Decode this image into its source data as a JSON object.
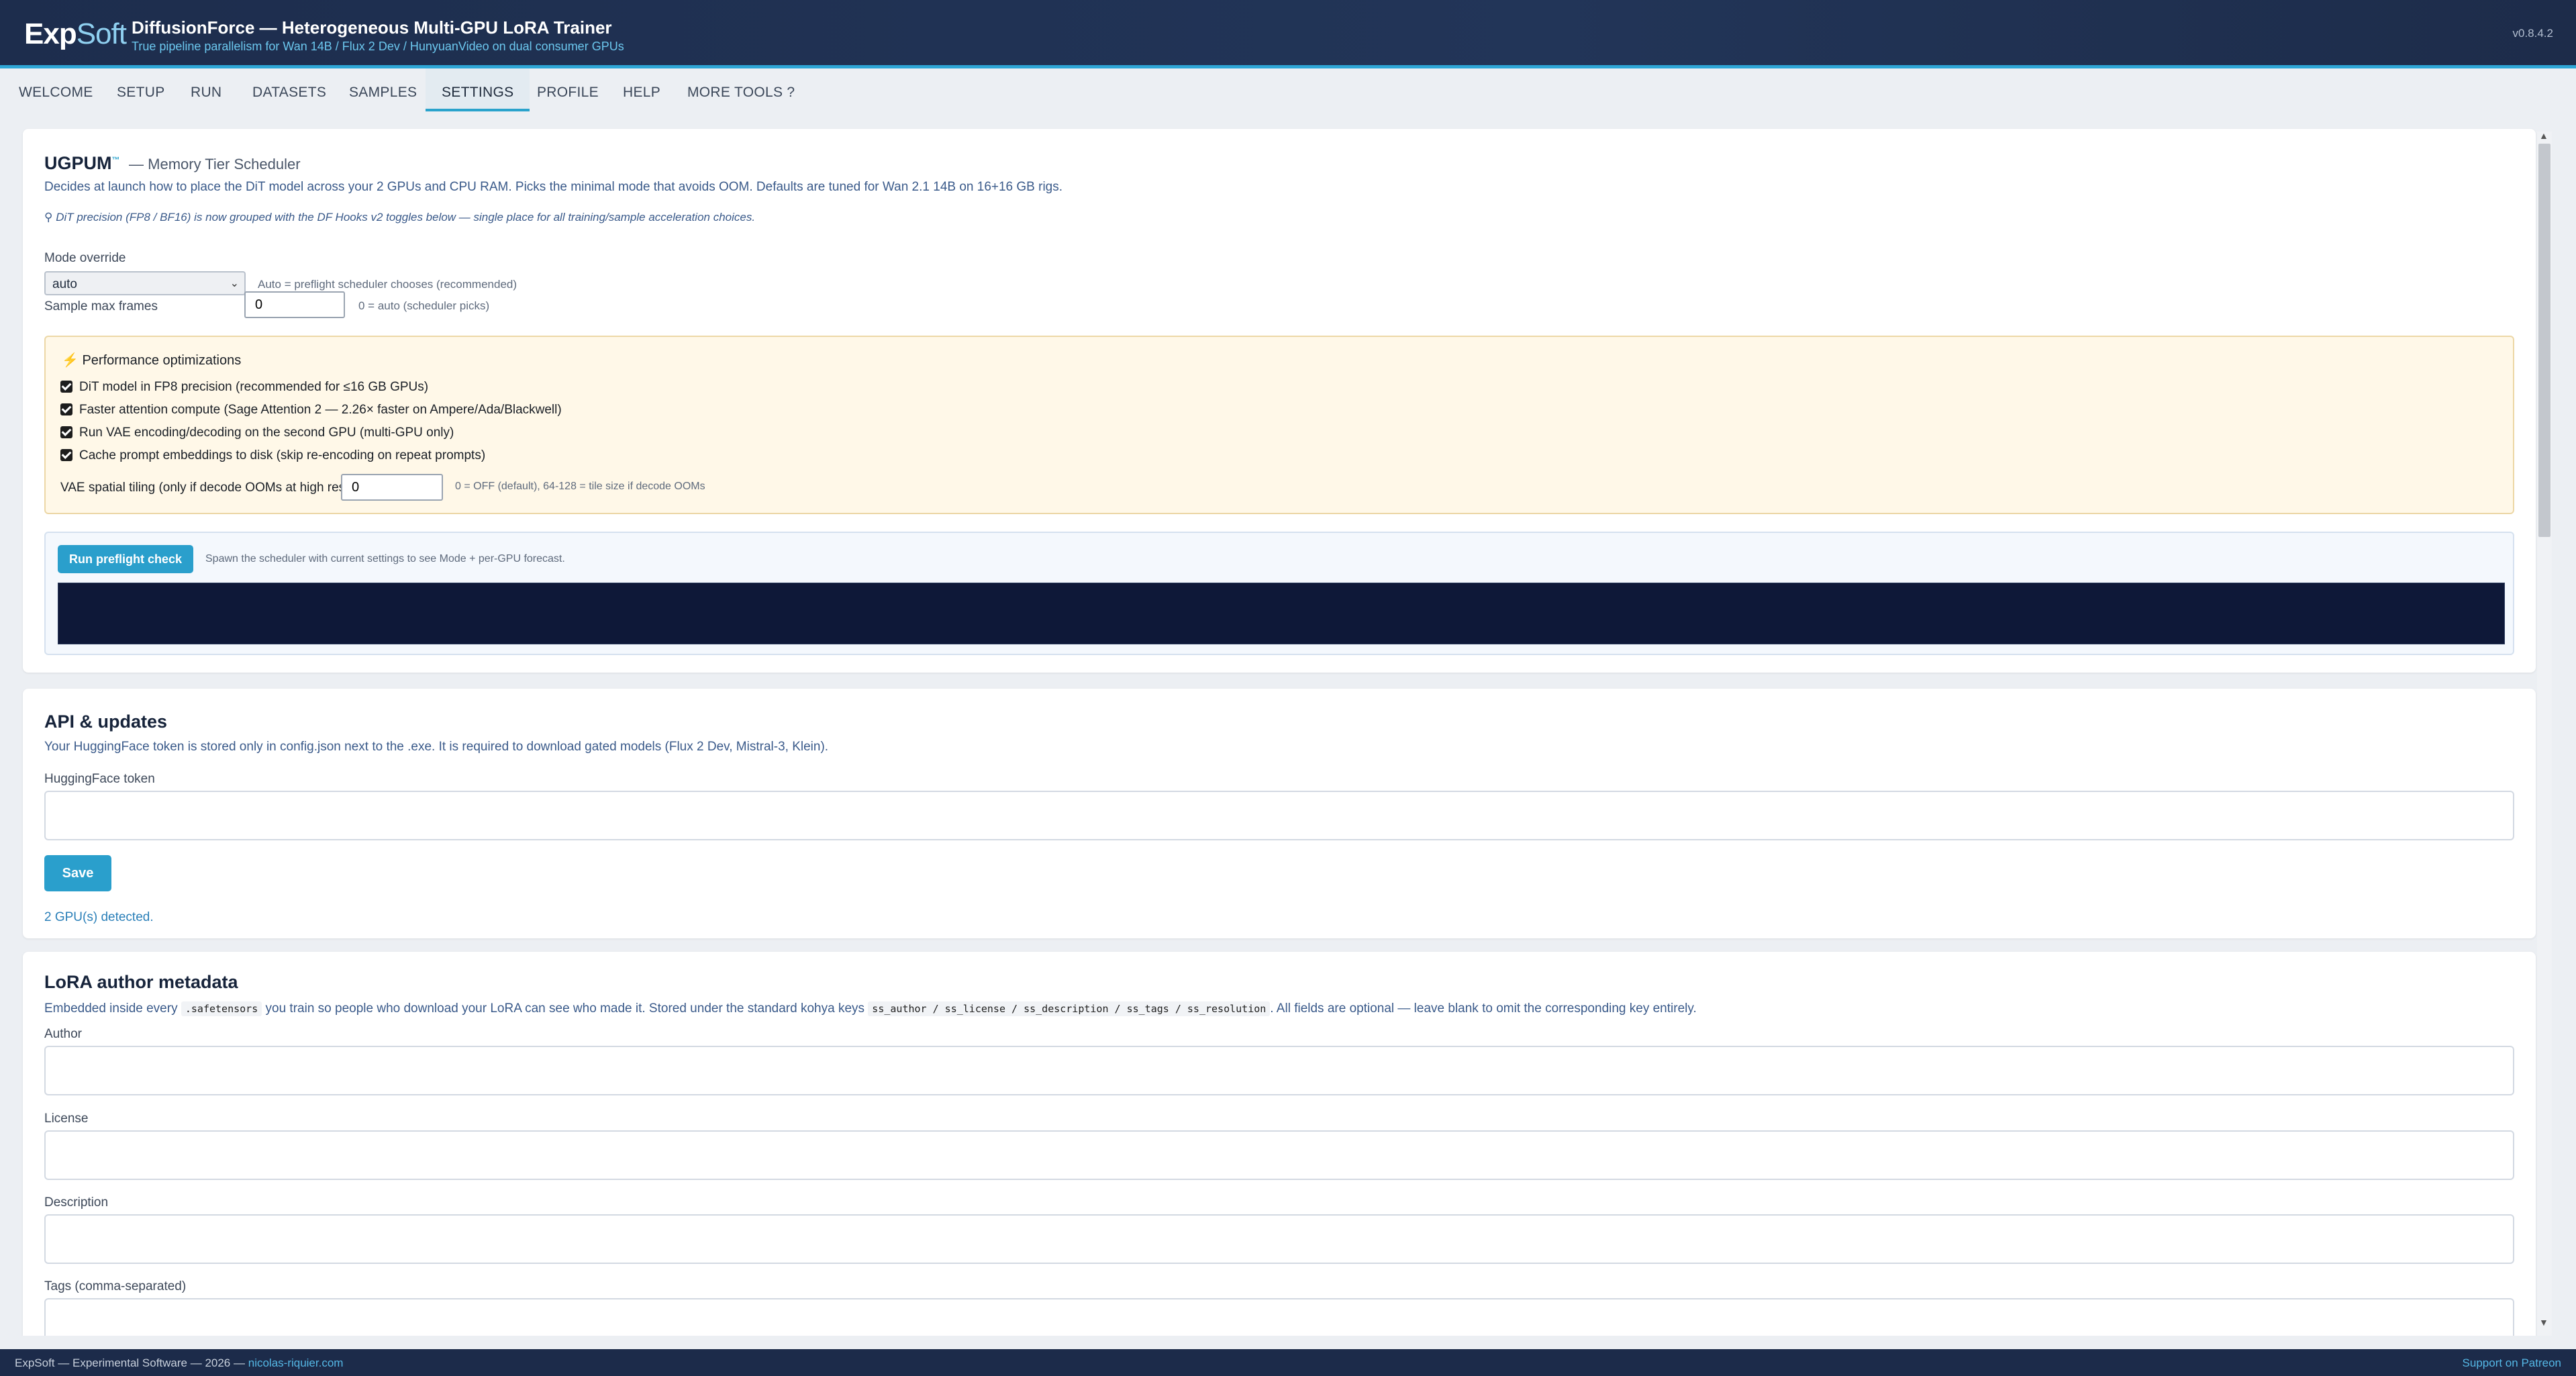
{
  "header": {
    "logo_bold": "Exp",
    "logo_rest": "Soft",
    "title": "DiffusionForce — Heterogeneous Multi-GPU LoRA Trainer",
    "subtitle": "True pipeline parallelism for Wan 14B / Flux 2 Dev / HunyuanVideo on dual consumer GPUs",
    "version": "v0.8.4.2"
  },
  "tabs": [
    {
      "label": "WELCOME"
    },
    {
      "label": "SETUP"
    },
    {
      "label": "RUN"
    },
    {
      "label": "DATASETS"
    },
    {
      "label": "SAMPLES"
    },
    {
      "label": "SETTINGS",
      "active": true
    },
    {
      "label": "PROFILE"
    },
    {
      "label": "HELP"
    },
    {
      "label": "MORE TOOLS ?"
    }
  ],
  "ugpum": {
    "title": "UGPUM",
    "tm": "™",
    "subtitle": "— Memory Tier Scheduler",
    "description": "Decides at launch how to place the DiT model across your 2 GPUs and CPU RAM. Picks the minimal mode that avoids OOM. Defaults are tuned for Wan 2.1 14B on 16+16 GB rigs.",
    "note": "DiT precision (FP8 / BF16) is now grouped with the DF Hooks v2 toggles below — single place for all training/sample acceleration choices.",
    "mode_label": "Mode override",
    "mode_value": "auto",
    "mode_hint": "Auto = preflight scheduler chooses (recommended)",
    "frames_label": "Sample max frames",
    "frames_value": "0",
    "frames_hint": "0 = auto (scheduler picks)",
    "perf": {
      "title": "Performance optimizations",
      "options": [
        {
          "label": "DiT model in FP8 precision (recommended for ≤16 GB GPUs)",
          "checked": true
        },
        {
          "label": "Faster attention compute (Sage Attention 2 — 2.26× faster on Ampere/Ada/Blackwell)",
          "checked": true
        },
        {
          "label": "Run VAE encoding/decoding on the second GPU (multi-GPU only)",
          "checked": true
        },
        {
          "label": "Cache prompt embeddings to disk (skip re-encoding on repeat prompts)",
          "checked": true
        }
      ],
      "tiling_label": "VAE spatial tiling (only if decode OOMs at high res):",
      "tiling_value": "0",
      "tiling_hint": "0 = OFF (default), 64-128 = tile size if decode OOMs"
    },
    "preflight_button": "Run preflight check",
    "preflight_hint": "Spawn the scheduler with current settings to see Mode + per-GPU forecast."
  },
  "api": {
    "title": "API & updates",
    "description": "Your HuggingFace token is stored only in config.json next to the .exe. It is required to download gated models (Flux 2 Dev, Mistral-3, Klein).",
    "token_label": "HuggingFace token",
    "token_value": "",
    "save_button": "Save",
    "status": "2 GPU(s) detected."
  },
  "lora_meta": {
    "title": "LoRA author metadata",
    "desc_1": "Embedded inside every",
    "desc_ext": ".safetensors",
    "desc_2": "you train so people who download your LoRA can see who made it. Stored under the standard kohya keys",
    "keys": "ss_author / ss_license / ss_description / ss_tags / ss_resolution",
    "desc_3": ". All fields are optional — leave blank to omit the corresponding key entirely.",
    "fields": [
      {
        "label": "Author",
        "value": ""
      },
      {
        "label": "License",
        "value": ""
      },
      {
        "label": "Description",
        "value": ""
      },
      {
        "label": "Tags (comma-separated)",
        "value": ""
      }
    ]
  },
  "footer": {
    "left": "ExpSoft — Experimental Software — 2026 —",
    "link": "nicolas-riquier.com",
    "right": "Support on Patreon"
  }
}
